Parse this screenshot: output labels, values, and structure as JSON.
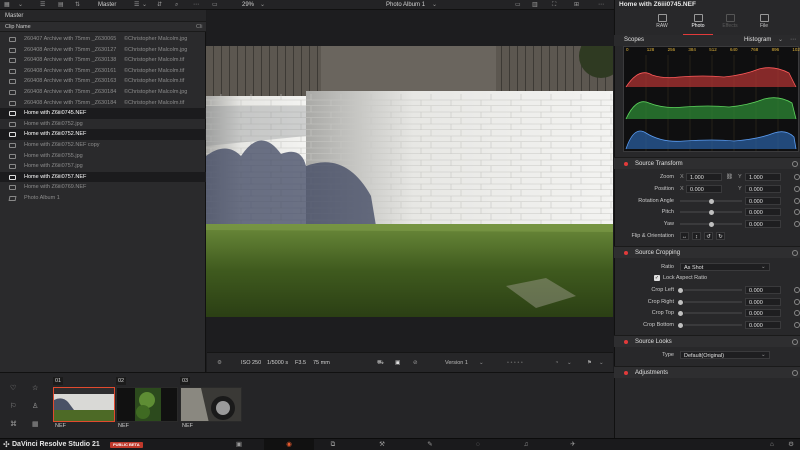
{
  "topbar": {
    "panel_title": "Master",
    "zoom": "29%",
    "viewer_title": "Photo Album 1",
    "chevron": "⌄"
  },
  "media_pool": {
    "bin": "Master",
    "col_clip_name": "Clip Name",
    "col_other": "Cli",
    "clips": [
      {
        "name": "260407 Archive with 75mm _Z630065",
        "meta": "©Christopher Malcolm.jpg",
        "selected": false,
        "icon": "image-icon"
      },
      {
        "name": "260408 Archive with 75mm _Z630127",
        "meta": "©Christopher Malcolm.jpg",
        "selected": false,
        "icon": "image-icon"
      },
      {
        "name": "260408 Archive with 75mm _Z630138",
        "meta": "©Christopher Malcolm.tif",
        "selected": false,
        "icon": "image-icon"
      },
      {
        "name": "260408 Archive with 75mm _Z630161",
        "meta": "©Christopher Malcolm.tif",
        "selected": false,
        "icon": "image-icon"
      },
      {
        "name": "260408 Archive with 75mm _Z630163",
        "meta": "©Christopher Malcolm.tif",
        "selected": false,
        "icon": "image-icon"
      },
      {
        "name": "260408 Archive with 75mm _Z630184",
        "meta": "©Christopher Malcolm.jpg",
        "selected": false,
        "icon": "image-icon"
      },
      {
        "name": "260408 Archive with 75mm _Z630184",
        "meta": "©Christopher Malcolm.tif",
        "selected": false,
        "icon": "image-icon"
      },
      {
        "name": "Home with Z6iii0745.NEF",
        "meta": "",
        "selected": true,
        "icon": "image-icon"
      },
      {
        "name": "Home with Z6iii0752.jpg",
        "meta": "",
        "selected": false,
        "icon": "image-icon"
      },
      {
        "name": "Home with Z6iii0752.NEF",
        "meta": "",
        "selected": true,
        "icon": "image-icon"
      },
      {
        "name": "Home with Z6iii0752.NEF copy",
        "meta": "",
        "selected": false,
        "icon": "image-icon"
      },
      {
        "name": "Home with Z6iii0755.jpg",
        "meta": "",
        "selected": false,
        "icon": "image-icon"
      },
      {
        "name": "Home with Z6iii0757.jpg",
        "meta": "",
        "selected": false,
        "icon": "image-icon"
      },
      {
        "name": "Home with Z6iii0757.NEF",
        "meta": "",
        "selected": true,
        "icon": "image-icon"
      },
      {
        "name": "Home with Z6iii0769.NEF",
        "meta": "",
        "selected": false,
        "icon": "image-icon"
      },
      {
        "name": "Photo Album 1",
        "meta": "",
        "selected": false,
        "icon": "album-icon"
      }
    ]
  },
  "viewer_footer": {
    "iso": "ISO 250",
    "shutter": "1/5000 s",
    "aperture": "F3.5",
    "focal": "75 mm",
    "version": "Version 1",
    "rating": "• • • • •"
  },
  "inspector": {
    "title": "Home with Z6iii0745.NEF",
    "tabs": [
      {
        "label": "RAW",
        "state": "normal"
      },
      {
        "label": "Photo",
        "state": "active"
      },
      {
        "label": "Effects",
        "state": "dim"
      },
      {
        "label": "File",
        "state": "normal"
      }
    ],
    "scopes_label": "Scopes",
    "scope_mode": "Histogram",
    "scope_ticks": [
      "0",
      "128",
      "256",
      "384",
      "512",
      "640",
      "768",
      "896",
      "1023"
    ],
    "source_transform": {
      "title": "Source Transform",
      "zoom_label": "Zoom",
      "zoom_x": "1.000",
      "zoom_y": "1.000",
      "position_label": "Position",
      "position_x": "0.000",
      "position_y": "0.000",
      "x_label": "X",
      "y_label": "Y",
      "rotation_label": "Rotation Angle",
      "rotation": "0.000",
      "pitch_label": "Pitch",
      "pitch": "0.000",
      "yaw_label": "Yaw",
      "yaw": "0.000",
      "flip_label": "Flip & Orientation"
    },
    "source_cropping": {
      "title": "Source Cropping",
      "ratio_label": "Ratio",
      "ratio_value": "As Shot",
      "lock_label": "Lock Aspect Ratio",
      "crop_left_label": "Crop Left",
      "crop_left": "0.000",
      "crop_right_label": "Crop Right",
      "crop_right": "0.000",
      "crop_top_label": "Crop Top",
      "crop_top": "0.000",
      "crop_bottom_label": "Crop Bottom",
      "crop_bottom": "0.000"
    },
    "source_looks": {
      "title": "Source Looks",
      "type_label": "Type",
      "type_value": "Default(Original)"
    },
    "adjustments_title": "Adjustments"
  },
  "strip": {
    "thumbs": [
      {
        "num": "01",
        "caption": "NEF",
        "selected": true
      },
      {
        "num": "02",
        "caption": "NEF",
        "selected": false
      },
      {
        "num": "03",
        "caption": "NEF",
        "selected": false
      }
    ]
  },
  "bottombar": {
    "brand": "DaVinci Resolve Studio 21",
    "beta": "PUBLIC BETA"
  },
  "colors": {
    "accent_red": "#e23a3a",
    "selection_orange": "#e24a2e"
  }
}
